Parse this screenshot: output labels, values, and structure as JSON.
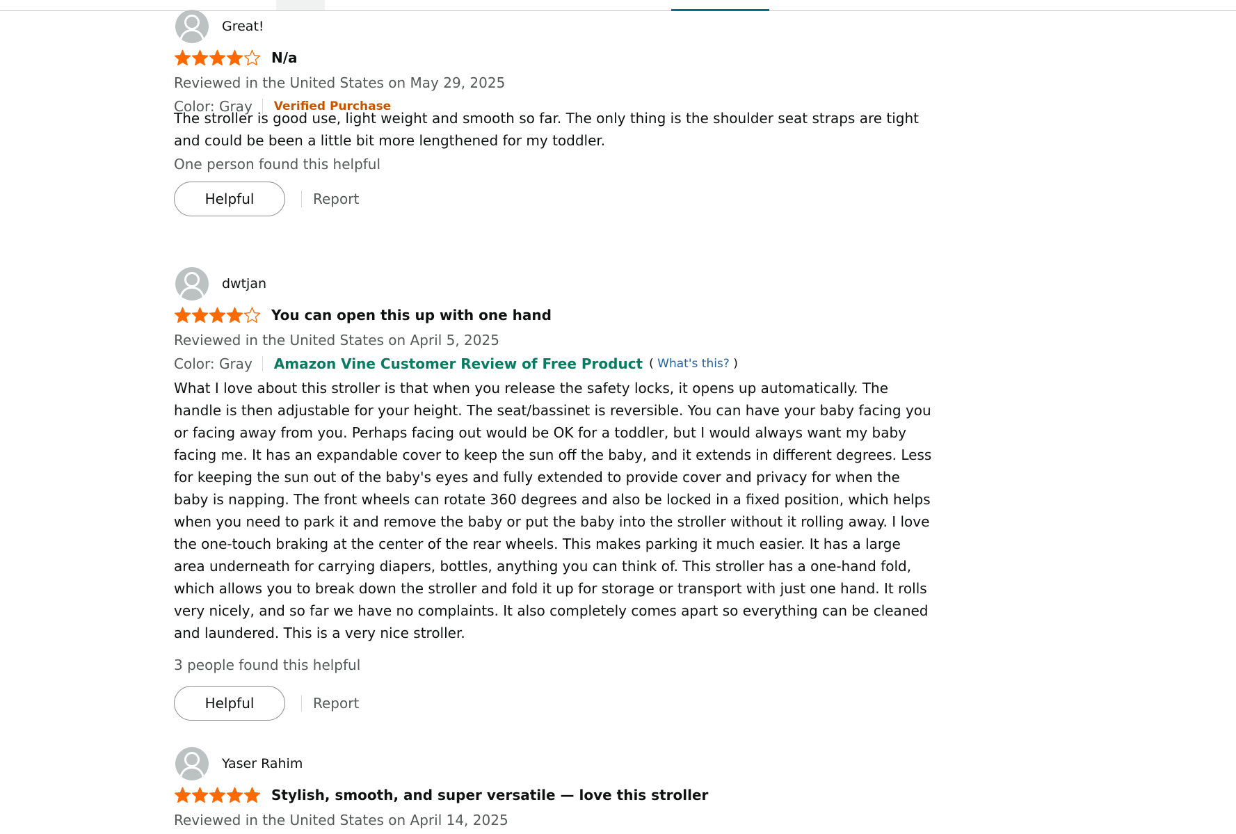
{
  "colors": {
    "star": "#ff6900",
    "verified": "#c45500",
    "vine": "#067d62",
    "link": "#2162a1",
    "muted_text": "#565959",
    "tab_active": "#007185"
  },
  "icons": {
    "avatar": "default-user-avatar-icon",
    "star_filled": "filled-star-icon",
    "star_empty": "empty-star-icon"
  },
  "reviews": [
    {
      "profile_name": "Great!",
      "rating": 4,
      "rating_max": 5,
      "title": "N/a",
      "date": "Reviewed in the United States on May 29, 2025",
      "color": "Color: Gray",
      "badge": "Verified Purchase",
      "body": "The stroller is good use, light weight and smooth so far. The only thing is the shoulder seat straps are tight and could be been a little bit more lengthened for my toddler.",
      "helpful_count": "One person found this helpful",
      "helpful_label": "Helpful",
      "report_label": "Report"
    },
    {
      "profile_name": "dwtjan",
      "rating": 4,
      "rating_max": 5,
      "title": "You can open this up with one hand",
      "date": "Reviewed in the United States on April 5, 2025",
      "color": "Color: Gray",
      "badge": "Amazon Vine Customer Review of Free Product",
      "badge_paren_open": "(",
      "badge_link": "What's this?",
      "badge_paren_close": ")",
      "body": "What I love about this stroller is that when you release the safety locks, it opens up automatically. The handle is then adjustable for your height. The seat/bassinet is reversible. You can have your baby facing you or facing away from you. Perhaps facing out would be OK for a toddler, but I would always want my baby facing me. It has an expandable cover to keep the sun off the baby, and it extends in different degrees. Less for keeping the sun out of the baby's eyes and fully extended to provide cover and privacy for when the baby is napping. The front wheels can rotate 360 degrees and also be locked in a fixed position, which helps when you need to park it and remove the baby or put the baby into the stroller without it rolling away. I love the one-touch braking at the center of the rear wheels. This makes parking it much easier. It has a large area underneath for carrying diapers, bottles, anything you can think of. This stroller has a one-hand fold, which allows you to break down the stroller and fold it up for storage or transport with just one hand. It rolls very nicely, and so far we have no complaints. It also completely comes apart so everything can be cleaned and laundered. This is a very nice stroller.",
      "helpful_count": "3 people found this helpful",
      "helpful_label": "Helpful",
      "report_label": "Report"
    },
    {
      "profile_name": "Yaser Rahim",
      "rating": 5,
      "rating_max": 5,
      "title": "Stylish, smooth, and super versatile — love this stroller",
      "date": "Reviewed in the United States on April 14, 2025"
    }
  ]
}
